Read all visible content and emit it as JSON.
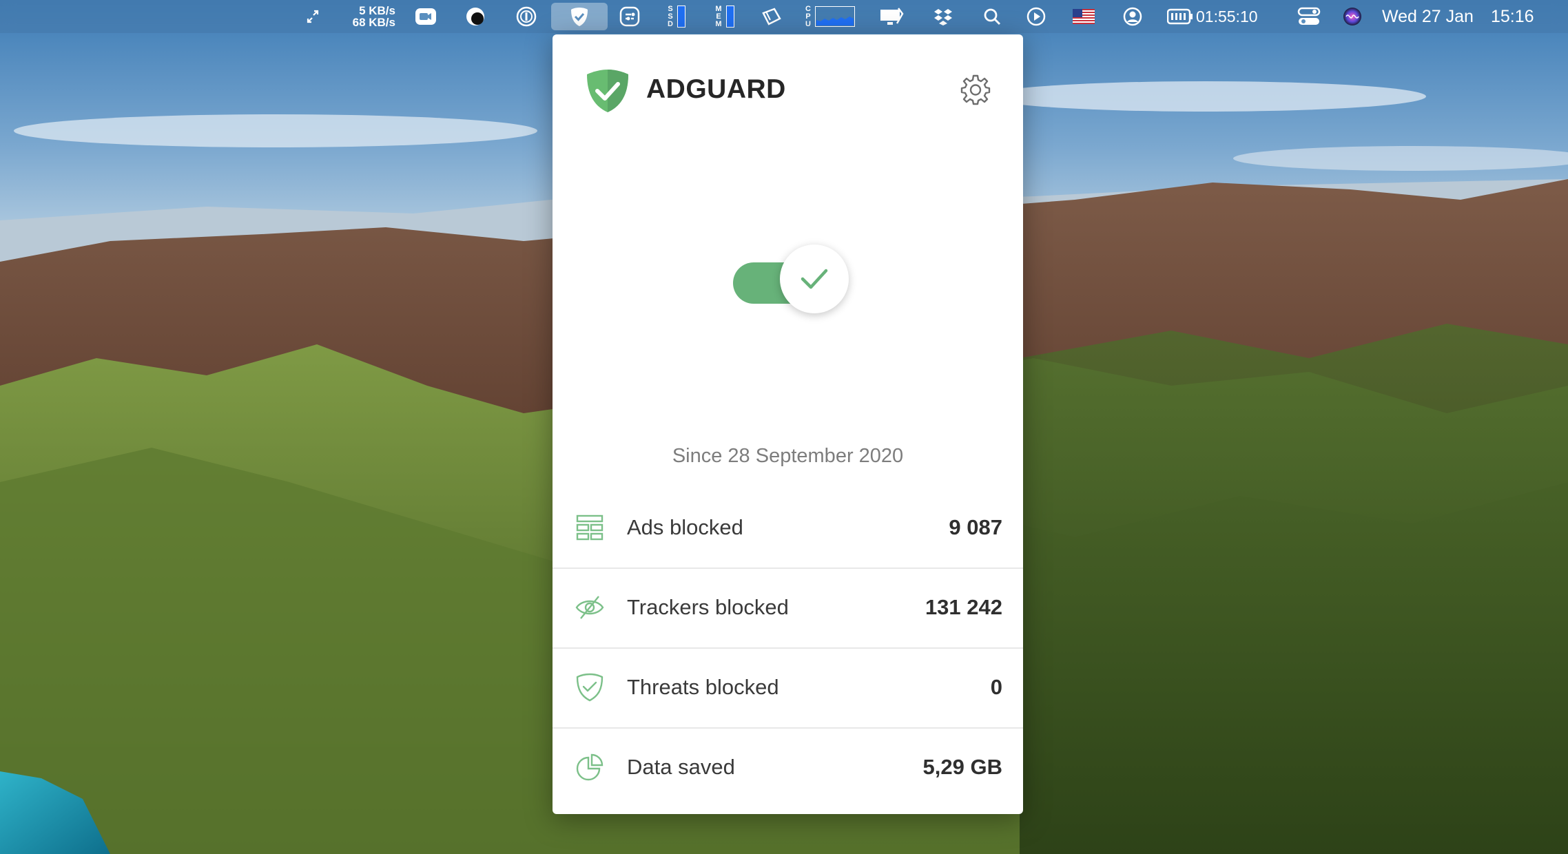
{
  "menubar": {
    "net_up": "5 KB/s",
    "net_down": "68 KB/s",
    "ssd_label": "SSD",
    "mem_label": "MEM",
    "cpu_label": "CPU",
    "battery_time": "01:55:10",
    "date": "Wed 27 Jan",
    "time": "15:16",
    "icons": [
      "expand-arrows-icon",
      "zoom-video-icon",
      "moon-icon",
      "1password-icon",
      "adguard-icon",
      "scripts-icon",
      "ssd-meter-icon",
      "mem-meter-icon",
      "clipboard-icon",
      "cpu-graph-icon",
      "screen-share-icon",
      "dropbox-icon",
      "spotlight-icon",
      "play-icon",
      "us-flag-icon",
      "user-icon",
      "battery-icon",
      "control-center-icon",
      "siri-icon"
    ]
  },
  "popover": {
    "brand": "ADGUARD",
    "protection_enabled": true,
    "since": "Since 28 September 2020",
    "stats": [
      {
        "icon": "ads-icon",
        "label": "Ads blocked",
        "value": "9 087"
      },
      {
        "icon": "tracker-eye-icon",
        "label": "Trackers blocked",
        "value": "131 242"
      },
      {
        "icon": "shield-check-icon",
        "label": "Threats blocked",
        "value": "0"
      },
      {
        "icon": "pie-chart-icon",
        "label": "Data saved",
        "value": "5,29 GB"
      }
    ]
  },
  "colors": {
    "accent_green": "#67b279",
    "logo_green": "#68bc71",
    "text_dark": "#262626",
    "text_muted": "#7d7d7d"
  }
}
